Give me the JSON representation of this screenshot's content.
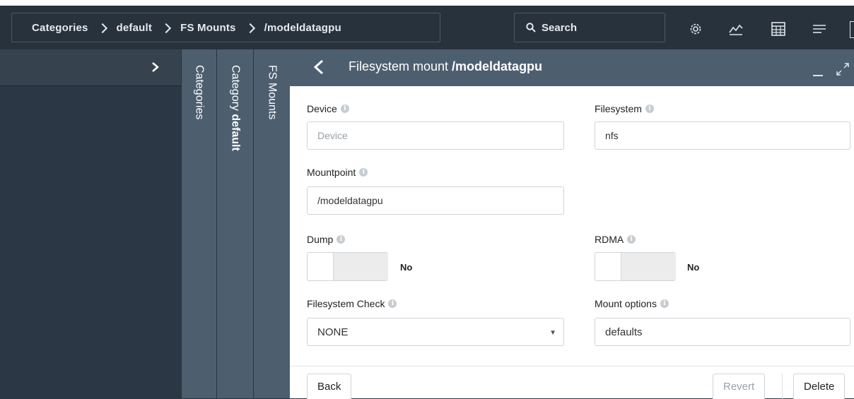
{
  "breadcrumb": [
    "Categories",
    "default",
    "FS Mounts",
    "/modeldatagpu"
  ],
  "search": {
    "label": "Search"
  },
  "toolbar_icons": [
    "settings-gear-icon",
    "chart-line-icon",
    "calculator-icon",
    "menu-lines-icon"
  ],
  "sidebar_columns": [
    {
      "prefix": "Categories",
      "bold": ""
    },
    {
      "prefix": "Category ",
      "bold": "default"
    },
    {
      "prefix": "FS Mounts",
      "bold": ""
    }
  ],
  "panel": {
    "title_prefix": "Filesystem mount ",
    "title_bold": "/modeldatagpu"
  },
  "form": {
    "device": {
      "label": "Device",
      "value": "",
      "placeholder": "Device"
    },
    "filesystem": {
      "label": "Filesystem",
      "value": "nfs"
    },
    "mountpoint": {
      "label": "Mountpoint",
      "value": "/modeldatagpu"
    },
    "dump": {
      "label": "Dump",
      "value": "No"
    },
    "rdma": {
      "label": "RDMA",
      "value": "No"
    },
    "fscheck": {
      "label": "Filesystem Check",
      "value": "NONE"
    },
    "mountopts": {
      "label": "Mount options",
      "value": "defaults"
    }
  },
  "footer": {
    "back": "Back",
    "revert": "Revert",
    "delete": "Delete"
  },
  "colors": {
    "topbar": "#27323d",
    "panel_header": "#4d5e6f",
    "background": "#2b3744"
  }
}
